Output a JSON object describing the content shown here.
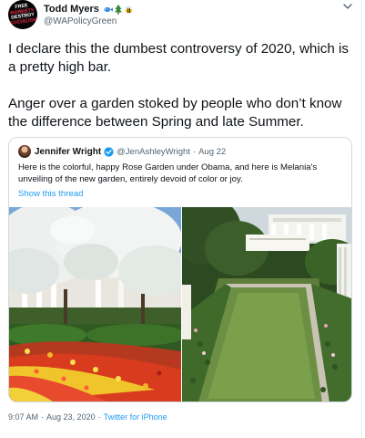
{
  "author": {
    "display_name": "Todd Myers",
    "handle": "@WAPolicyGreen",
    "avatar_lines": [
      "FREE",
      "MARKETS",
      "DESTROY",
      "SOCIALISM"
    ],
    "name_emojis": [
      "fish-icon",
      "evergreen-tree-icon",
      "bee-icon"
    ]
  },
  "tweet": {
    "paragraph_1": "I declare this the dumbest controversy of 2020, which is a pretty high bar.",
    "paragraph_2": "Anger over a garden stoked by people who don’t know the difference between Spring and late Summer."
  },
  "quoted": {
    "display_name": "Jennifer Wright",
    "handle": "@JenAshleyWright",
    "separator": "·",
    "date": "Aug 22",
    "text": "Here is the colorful, happy Rose Garden under Obama, and here is Melania's unveiling of the new garden, entirely devoid of color or joy.",
    "show_thread": "Show this thread",
    "images": [
      "rose-garden-spring-photo",
      "rose-garden-renovated-photo"
    ]
  },
  "meta": {
    "time": "9:07 AM",
    "separator": "·",
    "date": "Aug 23, 2020",
    "source": "Twitter for iPhone"
  },
  "colors": {
    "accent": "#1d9bf0",
    "text_primary": "#0f1419",
    "text_secondary": "#536471",
    "border": "#cfd9de"
  }
}
